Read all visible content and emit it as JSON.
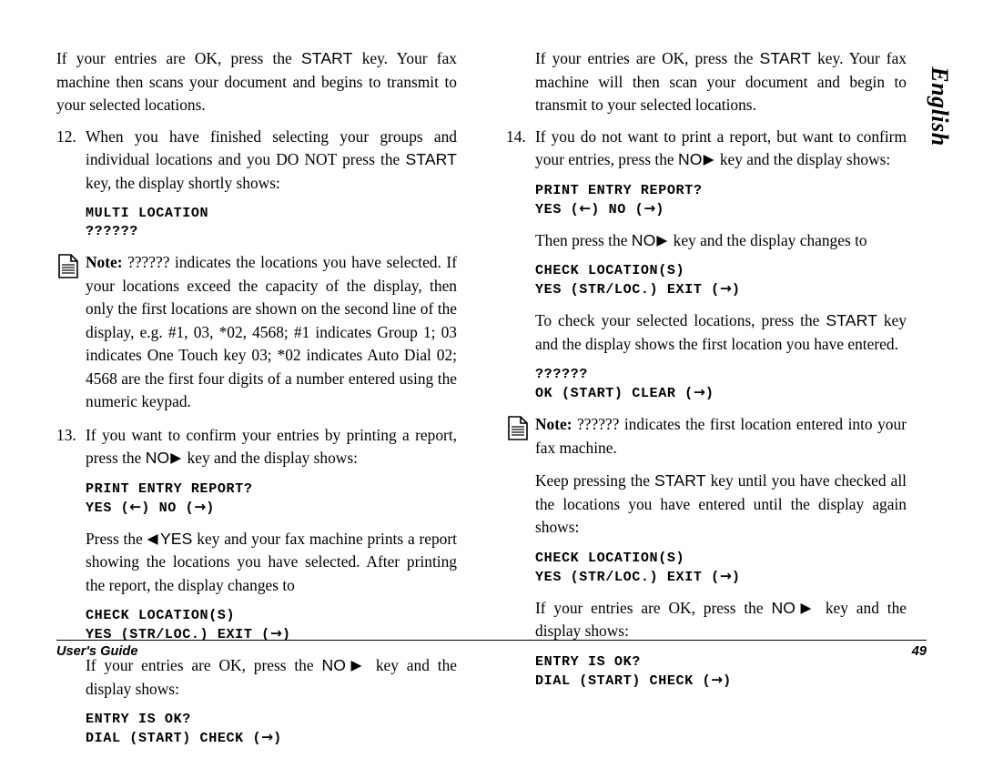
{
  "page": {
    "language_tab": "English",
    "footer_left": "User's Guide",
    "footer_page_number": "49"
  },
  "icons": {
    "note_icon": "document-page-icon",
    "right_triangle": "▶",
    "left_triangle": "◀",
    "arrow_left": "←",
    "arrow_right": "→"
  },
  "left_column": {
    "intro_paragraph": {
      "before_key": "If your entries are OK, press the ",
      "key": "START",
      "after_key": " key. Your fax machine then scans your document and begins to transmit to your selected locations."
    },
    "item12": {
      "number": "12.",
      "text_part1": "When you have finished selecting your groups and individual locations and you DO NOT press the ",
      "key": "START",
      "text_part2": " key, the display shortly shows:"
    },
    "display1": {
      "line1": "MULTI LOCATION",
      "line2": "??????"
    },
    "note1": {
      "label": "Note:",
      "text": " ?????? indicates the locations you have selected. If your locations exceed the capacity of the display, then only the first locations are shown on the second line of the display, e.g. #1, 03, *02, 4568; #1 indicates Group 1; 03 indicates One Touch key 03; *02 indicates Auto Dial 02; 4568 are the first four digits of a number entered using the numeric keypad."
    },
    "item13": {
      "number": "13.",
      "text_part1": "If you want to confirm your entries by printing a report, press the ",
      "key": "NO",
      "text_part2": " key and the display shows:"
    },
    "display2": {
      "line1": "PRINT ENTRY REPORT?",
      "line2_a": "YES (",
      "line2_arrow1": "←",
      "line2_b": ") NO (",
      "line2_arrow2": "→",
      "line2_c": ")"
    },
    "para_press_yes": {
      "before_key": "Press the ",
      "key": "YES",
      "after_key": " key and your fax machine prints a report showing the locations you have selected. After printing the report, the display changes to"
    },
    "display3": {
      "line1": "CHECK LOCATION(S)",
      "line2_a": "YES (STR/LOC.) EXIT (",
      "line2_arrow": "→",
      "line2_b": ")"
    },
    "para_entries_ok": {
      "before_key": "If your entries are OK, press the ",
      "key": "NO",
      "after_key": " key and the display shows:"
    },
    "display4": {
      "line1": "ENTRY IS OK?",
      "line2_a": "DIAL (START) CHECK (",
      "line2_arrow": "→",
      "line2_b": ")"
    }
  },
  "right_column": {
    "intro_paragraph": {
      "before_key": "If your entries are OK, press the ",
      "key": "START",
      "after_key": " key. Your fax machine will then scan your document and begin to transmit to your selected locations."
    },
    "item14": {
      "number": "14.",
      "text_part1": "If you do not want to print a report, but want to confirm your entries, press the ",
      "key": "NO",
      "text_part2": " key and the display shows:"
    },
    "display1": {
      "line1": "PRINT ENTRY REPORT?",
      "line2_a": "YES (",
      "line2_arrow1": "←",
      "line2_b": ") NO (",
      "line2_arrow2": "→",
      "line2_c": ")"
    },
    "para_then_press": {
      "before_key": "Then press the ",
      "key": "NO",
      "after_key": " key and the display changes to"
    },
    "display2": {
      "line1": "CHECK LOCATION(S)",
      "line2_a": "YES (STR/LOC.) EXIT (",
      "line2_arrow": "→",
      "line2_b": ")"
    },
    "para_to_check": {
      "before_key": "To check your selected locations, press the ",
      "key": "START",
      "after_key": " key and the display shows the first location you have entered."
    },
    "display3": {
      "line1": "??????",
      "line2_a": "OK (START) CLEAR (",
      "line2_arrow": "→",
      "line2_b": ")"
    },
    "note1": {
      "label": "Note:",
      "text": " ?????? indicates the first location entered into your fax machine."
    },
    "para_keep_pressing": {
      "before_key": "Keep pressing the ",
      "key": "START",
      "after_key": " key until you have checked all the locations you have entered until the display again shows:"
    },
    "display4": {
      "line1": "CHECK LOCATION(S)",
      "line2_a": "YES (STR/LOC.) EXIT (",
      "line2_arrow": "→",
      "line2_b": ")"
    },
    "para_entries_ok": {
      "before_key": "If your entries are OK, press the ",
      "key": "NO",
      "after_key": " key and the display shows:"
    },
    "display5": {
      "line1": "ENTRY IS OK?",
      "line2_a": "DIAL (START) CHECK (",
      "line2_arrow": "→",
      "line2_b": ")"
    }
  }
}
